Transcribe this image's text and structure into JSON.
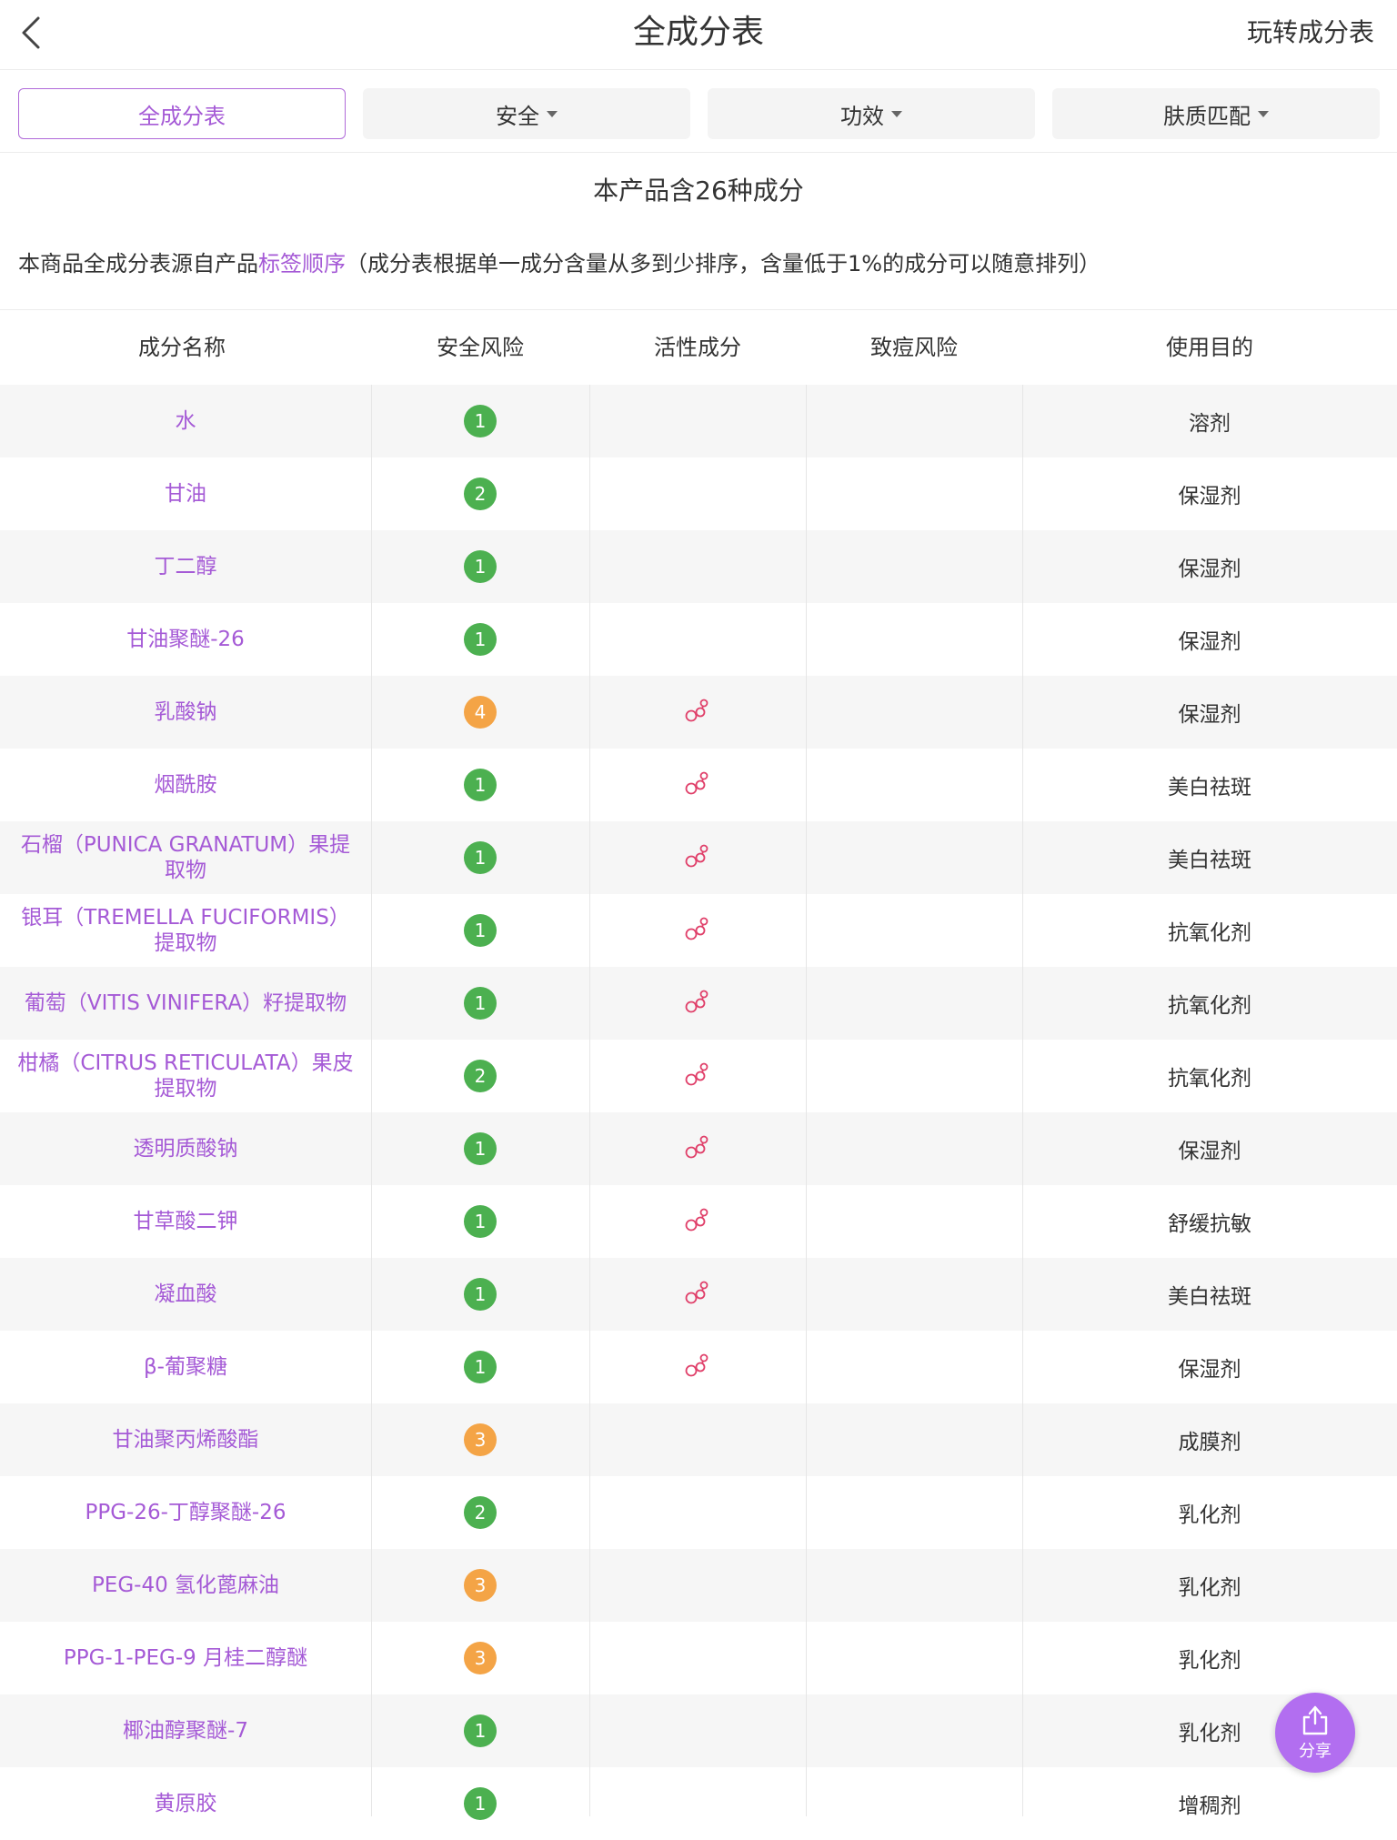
{
  "header": {
    "title": "全成分表",
    "help_link": "玩转成分表"
  },
  "filters": [
    {
      "label": "全成分表",
      "active": true,
      "has_caret": false
    },
    {
      "label": "安全",
      "active": false,
      "has_caret": true
    },
    {
      "label": "功效",
      "active": false,
      "has_caret": true
    },
    {
      "label": "肤质匹配",
      "active": false,
      "has_caret": true
    }
  ],
  "summary": "本产品含26种成分",
  "note": {
    "prefix": "本商品全成分表源自产品",
    "highlight": "标签顺序",
    "suffix": "（成分表根据单一成分含量从多到少排序，含量低于1%的成分可以随意排列）"
  },
  "table": {
    "headers": [
      "成分名称",
      "安全风险",
      "活性成分",
      "致痘风险",
      "使用目的"
    ],
    "rows": [
      {
        "name": "水",
        "safety": "1",
        "active": false,
        "acne": "",
        "purpose": "溶剂"
      },
      {
        "name": "甘油",
        "safety": "2",
        "active": false,
        "acne": "",
        "purpose": "保湿剂"
      },
      {
        "name": "丁二醇",
        "safety": "1",
        "active": false,
        "acne": "",
        "purpose": "保湿剂"
      },
      {
        "name": "甘油聚醚-26",
        "safety": "1",
        "active": false,
        "acne": "",
        "purpose": "保湿剂"
      },
      {
        "name": "乳酸钠",
        "safety": "4",
        "active": true,
        "acne": "",
        "purpose": "保湿剂"
      },
      {
        "name": "烟酰胺",
        "safety": "1",
        "active": true,
        "acne": "",
        "purpose": "美白祛斑"
      },
      {
        "name": "石榴（PUNICA GRANATUM）果提取物",
        "safety": "1",
        "active": true,
        "acne": "",
        "purpose": "美白祛斑"
      },
      {
        "name": "银耳（TREMELLA FUCIFORMIS）提取物",
        "safety": "1",
        "active": true,
        "acne": "",
        "purpose": "抗氧化剂"
      },
      {
        "name": "葡萄（VITIS VINIFERA）籽提取物",
        "safety": "1",
        "active": true,
        "acne": "",
        "purpose": "抗氧化剂"
      },
      {
        "name": "柑橘（CITRUS RETICULATA）果皮提取物",
        "safety": "2",
        "active": true,
        "acne": "",
        "purpose": "抗氧化剂"
      },
      {
        "name": "透明质酸钠",
        "safety": "1",
        "active": true,
        "acne": "",
        "purpose": "保湿剂"
      },
      {
        "name": "甘草酸二钾",
        "safety": "1",
        "active": true,
        "acne": "",
        "purpose": "舒缓抗敏"
      },
      {
        "name": "凝血酸",
        "safety": "1",
        "active": true,
        "acne": "",
        "purpose": "美白祛斑"
      },
      {
        "name": "β-葡聚糖",
        "safety": "1",
        "active": true,
        "acne": "",
        "purpose": "保湿剂"
      },
      {
        "name": "甘油聚丙烯酸酯",
        "safety": "3",
        "active": false,
        "acne": "",
        "purpose": "成膜剂"
      },
      {
        "name": "PPG-26-丁醇聚醚-26",
        "safety": "2",
        "active": false,
        "acne": "",
        "purpose": "乳化剂"
      },
      {
        "name": "PEG-40 氢化蓖麻油",
        "safety": "3",
        "active": false,
        "acne": "",
        "purpose": "乳化剂"
      },
      {
        "name": "PPG-1-PEG-9 月桂二醇醚",
        "safety": "3",
        "active": false,
        "acne": "",
        "purpose": "乳化剂"
      },
      {
        "name": "椰油醇聚醚-7",
        "safety": "1",
        "active": false,
        "acne": "",
        "purpose": "乳化剂"
      },
      {
        "name": "黄原胶",
        "safety": "1",
        "active": false,
        "acne": "",
        "purpose": "增稠剂"
      }
    ]
  },
  "share": {
    "label": "分享"
  },
  "colors": {
    "accent": "#a55ad6",
    "safe_low": "#4cb050",
    "safe_mid": "#f4a446",
    "active_icon": "#e0406a",
    "share_bg": "#b26ef0"
  },
  "icons": {
    "back": "chevron-left-icon",
    "active": "molecule-icon",
    "share": "share-upload-icon"
  }
}
